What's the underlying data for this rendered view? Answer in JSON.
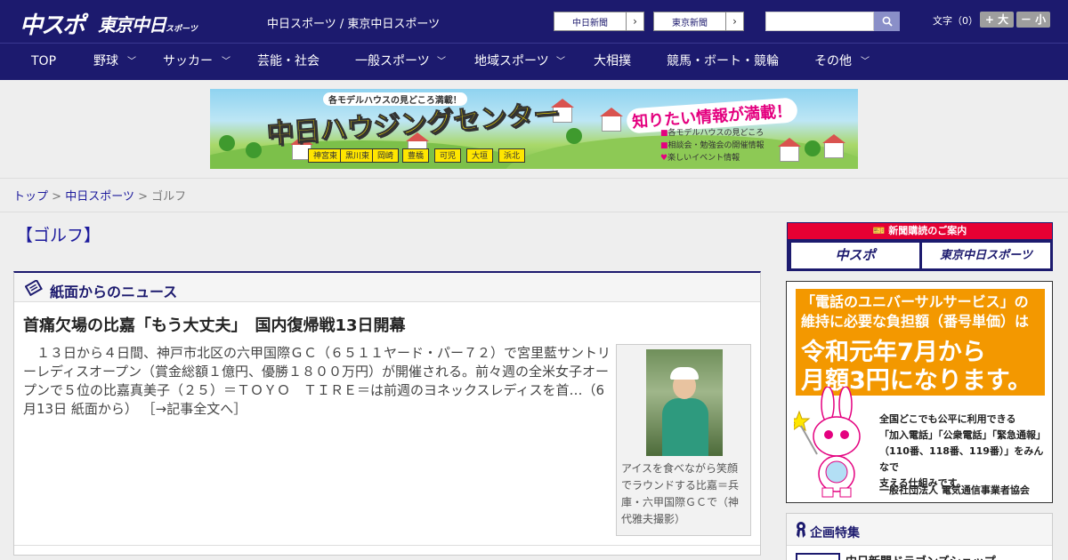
{
  "header": {
    "logo_chuspo": "中スポ",
    "logo_tokyo": "東京中日",
    "logo_tokyo_sub": "スポーツ",
    "site_names": "中日スポーツ / 東京中日スポーツ",
    "links": [
      {
        "label": "中日新聞"
      },
      {
        "label": "東京新聞"
      }
    ],
    "search_placeholder": "",
    "fontsize_label": "文字（0）",
    "fontsize_up": "+ 大",
    "fontsize_down": "－ 小"
  },
  "nav": {
    "items": [
      {
        "label": "TOP",
        "dropdown": false
      },
      {
        "label": "野球",
        "dropdown": true
      },
      {
        "label": "サッカー",
        "dropdown": true
      },
      {
        "label": "芸能・社会",
        "dropdown": false
      },
      {
        "label": "一般スポーツ",
        "dropdown": true
      },
      {
        "label": "地域スポーツ",
        "dropdown": true
      },
      {
        "label": "大相撲",
        "dropdown": false
      },
      {
        "label": "競馬・ボート・競輪",
        "dropdown": false
      },
      {
        "label": "その他",
        "dropdown": true
      }
    ]
  },
  "banner": {
    "caption": "各モデルハウスの見どころ満載！",
    "title": "中日ハウジングセンター",
    "slogan": "知りたい情報が満載！",
    "cities": [
      "神宮東",
      "黒川東",
      "岡崎",
      "豊橋",
      "可児",
      "大垣",
      "浜北"
    ],
    "features": [
      "各モデルハウスの見どころ",
      "相談会・勉強会の開催情報",
      "楽しいイベント情報"
    ]
  },
  "breadcrumb": {
    "top": "トップ",
    "sep": ">",
    "section": "中日スポーツ",
    "current": "ゴルフ"
  },
  "main": {
    "heading": "【ゴルフ】",
    "box_title": "紙面からのニュース",
    "article": {
      "title": "首痛欠場の比嘉「もう大丈夫」　国内復帰戦13日開幕",
      "body": "　１３日から４日間、神戸市北区の六甲国際ＧＣ（６５１１ヤード・パー７２）で宮里藍サントリーレディスオープン（賞金総額１億円、優勝１８００万円）が開催される。前々週の全米女子オープンで５位の比嘉真美子（２５）＝ＴＯＹＯ　ＴＩＲＥ＝は前週のヨネックスレディスを首…（6月13日 紙面から）",
      "more_link": "［→記事全文へ］",
      "photo_caption": "アイスを食べながら笑顔でラウンドする比嘉＝兵庫・六甲国際ＧＣで（神代雅夫撮影）"
    }
  },
  "sidebar": {
    "subscribe_head": "新聞購読のご案内",
    "subscribe_buttons": [
      "中スポ",
      "東京中日スポーツ"
    ],
    "ad": {
      "line1a": "「電話のユニバーサルサービス」の",
      "line1b": "維持に必要な負担額（番号単価）は",
      "line2a": "令和元年7月から",
      "line2b": "月額3円になります。",
      "text": [
        "全国どこでも公平に利用できる",
        "「加入電話」「公衆電話」「緊急通報」",
        "（110番、118番、119番）」をみんなで",
        "支える仕組みです。"
      ],
      "org": "一般社団法人 電気通信事業者協会"
    },
    "kikaku_title": "企画特集",
    "kikaku_item": "中日新聞ドラゴンズショップ"
  },
  "colors": {
    "brand_navy": "#1c1a6e",
    "link_blue": "#1c1a9c",
    "accent_red": "#e60033",
    "ad_orange": "#f39800"
  }
}
